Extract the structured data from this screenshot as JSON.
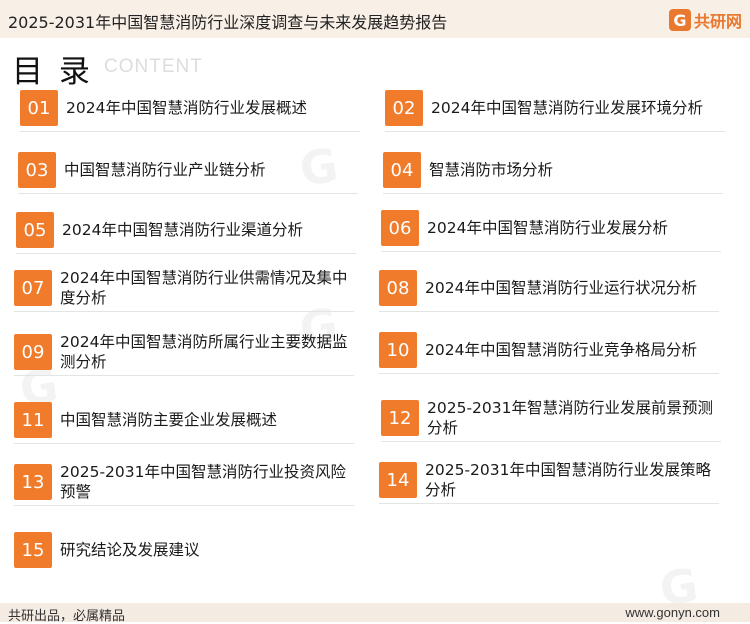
{
  "header": {
    "title": "2025-2031年中国智慧消防行业深度调查与未来发展趋势报告",
    "logo_text": "共研网"
  },
  "toc": {
    "heading": "目 录",
    "subheading": "CONTENT"
  },
  "items": [
    {
      "num": "01",
      "label": "2024年中国智慧消防行业发展概述"
    },
    {
      "num": "02",
      "label": "2024年中国智慧消防行业发展环境分析"
    },
    {
      "num": "03",
      "label": "中国智慧消防行业产业链分析"
    },
    {
      "num": "04",
      "label": "智慧消防市场分析"
    },
    {
      "num": "05",
      "label": "2024年中国智慧消防行业渠道分析"
    },
    {
      "num": "06",
      "label": "2024年中国智慧消防行业发展分析"
    },
    {
      "num": "07",
      "label": "2024年中国智慧消防行业供需情况及集中度分析"
    },
    {
      "num": "08",
      "label": "2024年中国智慧消防行业运行状况分析"
    },
    {
      "num": "09",
      "label": "2024年中国智慧消防所属行业主要数据监测分析"
    },
    {
      "num": "10",
      "label": "2024年中国智慧消防行业竞争格局分析"
    },
    {
      "num": "11",
      "label": "中国智慧消防主要企业发展概述"
    },
    {
      "num": "12",
      "label": "2025-2031年智慧消防行业发展前景预测分析"
    },
    {
      "num": "13",
      "label": "2025-2031年中国智慧消防行业投资风险预警"
    },
    {
      "num": "14",
      "label": "2025-2031年中国智慧消防行业发展策略分析"
    },
    {
      "num": "15",
      "label": "研究结论及发展建议"
    }
  ],
  "footer": {
    "left": "共研出品，必属精品",
    "right": "www.gonyn.com"
  },
  "colors": {
    "accent": "#f07b2a",
    "topbar_bg": "#f8efe6"
  }
}
